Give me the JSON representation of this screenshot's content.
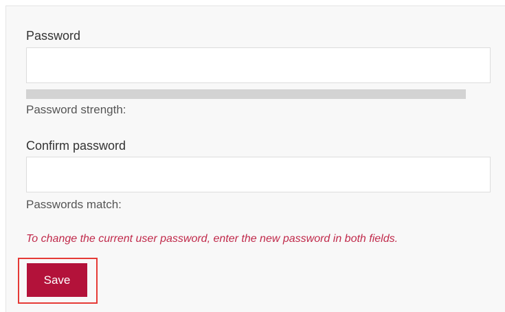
{
  "form": {
    "password_label": "Password",
    "password_value": "",
    "strength_label": "Password strength:",
    "strength_fraction": 0,
    "confirm_label": "Confirm password",
    "confirm_value": "",
    "match_label": "Passwords match:",
    "info_text": "To change the current user password, enter the new password in both fields.",
    "save_label": "Save"
  },
  "colors": {
    "accent": "#b3123a",
    "info_text": "#c0294a",
    "highlight": "#e53935"
  }
}
